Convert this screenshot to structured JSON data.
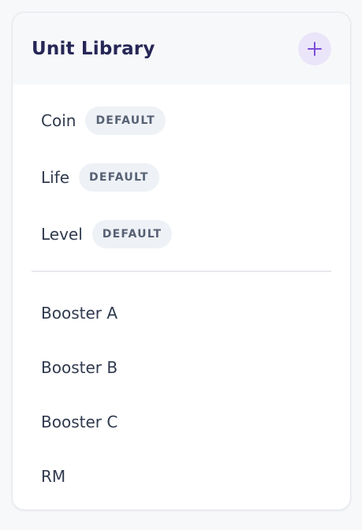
{
  "header": {
    "title": "Unit Library",
    "add_icon": "plus-icon",
    "accent_color": "#7c4dd8"
  },
  "default_units": [
    {
      "label": "Coin",
      "badge": "DEFAULT"
    },
    {
      "label": "Life",
      "badge": "DEFAULT"
    },
    {
      "label": "Level",
      "badge": "DEFAULT"
    }
  ],
  "custom_units": [
    {
      "label": "Booster A"
    },
    {
      "label": "Booster B"
    },
    {
      "label": "Booster C"
    },
    {
      "label": "RM"
    }
  ]
}
